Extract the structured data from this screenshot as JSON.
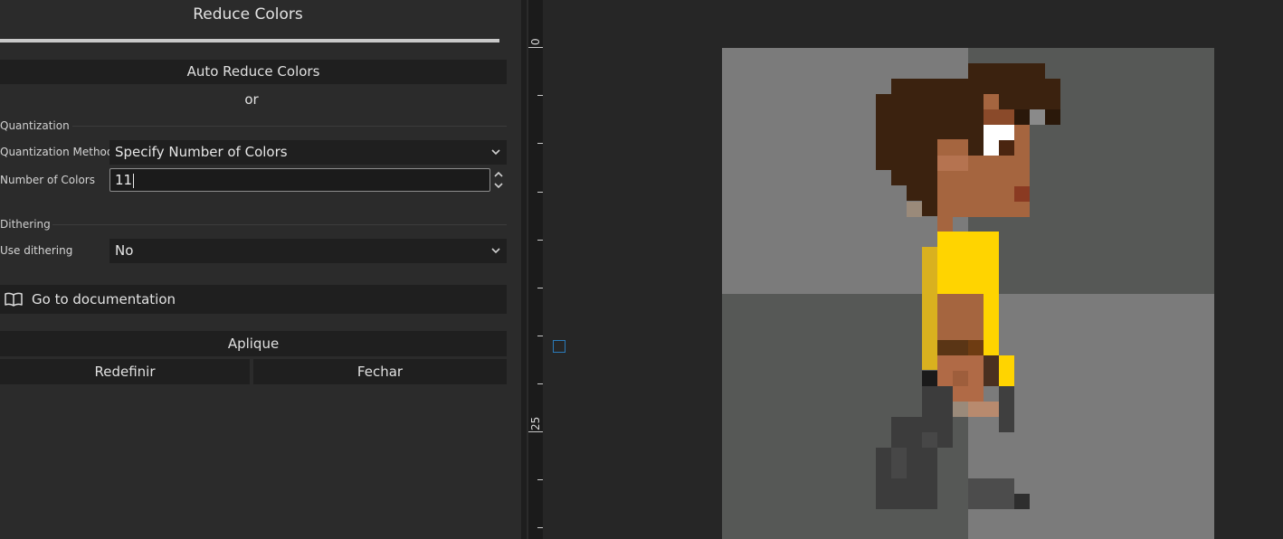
{
  "dialog": {
    "title": "Reduce Colors",
    "progress": 1.0,
    "auto_reduce_label": "Auto Reduce Colors",
    "or_label": "or",
    "quantization": {
      "section_label": "Quantization",
      "method_label": "Quantization Method",
      "method_value": "Specify Number of Colors",
      "count_label": "Number of Colors",
      "count_value": "11"
    },
    "dithering": {
      "section_label": "Dithering",
      "use_label": "Use dithering",
      "use_value": "No"
    },
    "docs_label": "Go to documentation",
    "apply_label": "Aplique",
    "reset_label": "Redefinir",
    "close_label": "Fechar"
  },
  "ruler": {
    "labels": [
      "0",
      "25"
    ]
  },
  "icons": {
    "dropdown": "chevron-down-icon",
    "spin_up": "chevron-up-icon",
    "spin_down": "chevron-down-icon",
    "docs": "book-icon"
  },
  "colors": {
    "panel_bg": "#2b2b2b",
    "button_bg": "#1f1f1f",
    "canvas_bg": "#262626",
    "checker_light": "#7b7b7b",
    "checker_dark": "#565856",
    "marker": "#2b7bb9"
  }
}
